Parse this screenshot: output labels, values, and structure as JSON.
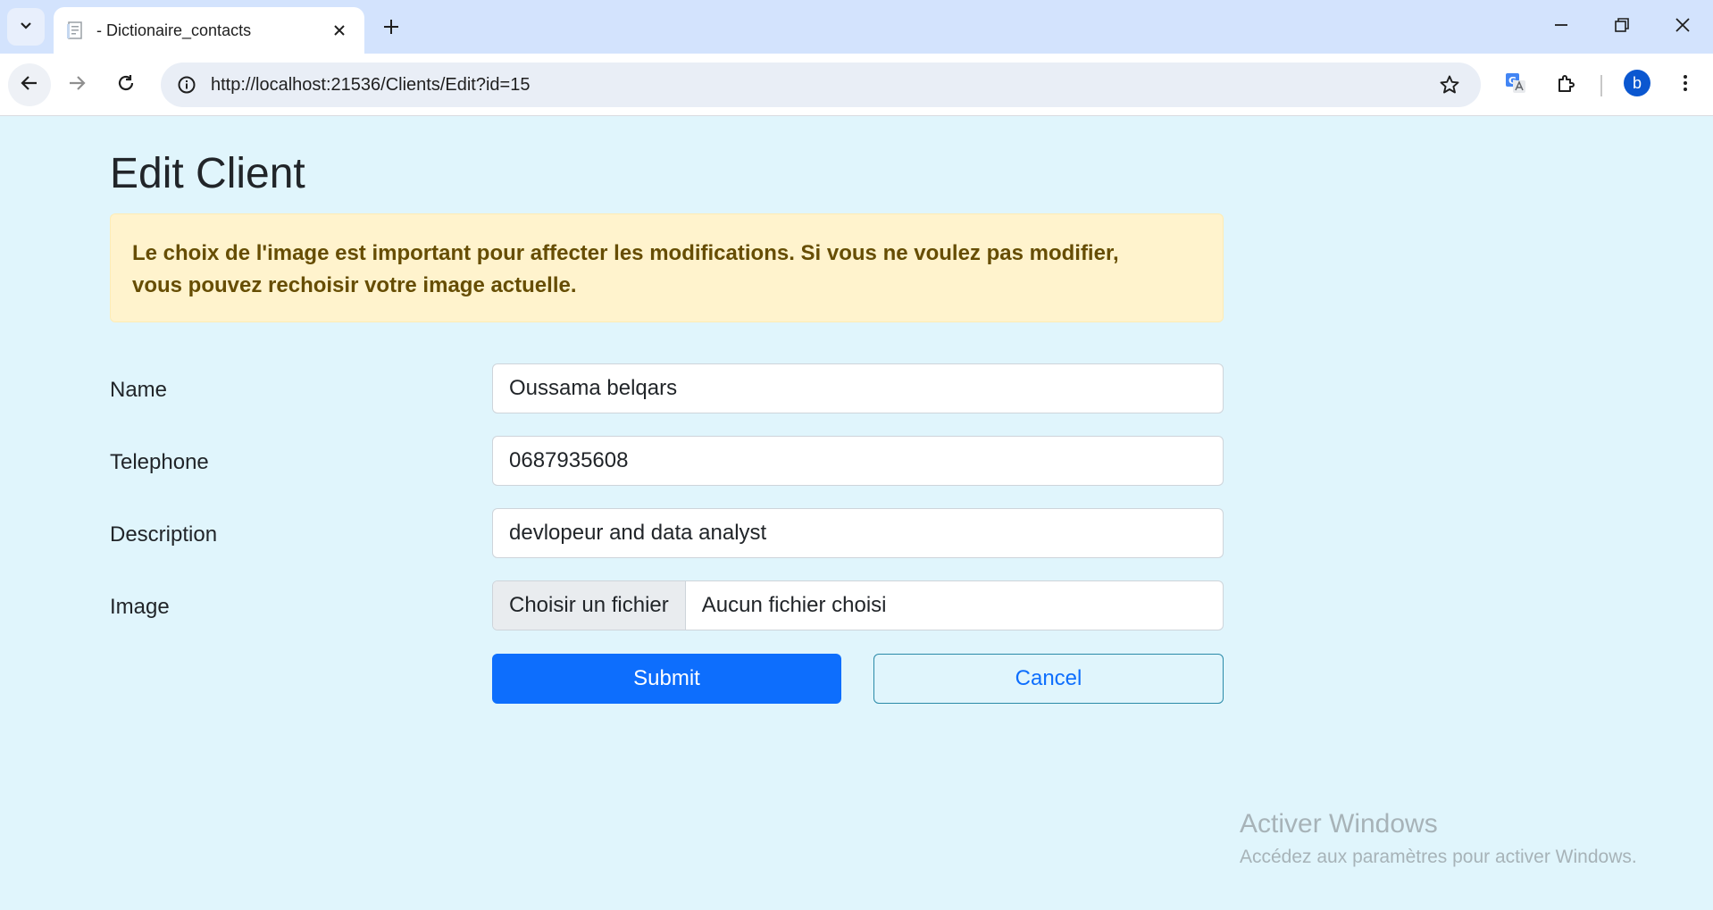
{
  "browser": {
    "tab_title": "- Dictionaire_contacts",
    "url": "http://localhost:21536/Clients/Edit?id=15",
    "profile_initial": "b"
  },
  "page": {
    "title": "Edit Client",
    "alert": "Le choix de l'image est important pour affecter les modifications. Si vous ne voulez pas modifier, vous pouvez rechoisir votre image actuelle.",
    "form": {
      "name_label": "Name",
      "name_value": "Oussama belqars",
      "telephone_label": "Telephone",
      "telephone_value": "0687935608",
      "description_label": "Description",
      "description_value": "devlopeur and data analyst",
      "image_label": "Image",
      "file_button": "Choisir un fichier",
      "file_status": "Aucun fichier choisi"
    },
    "submit_label": "Submit",
    "cancel_label": "Cancel"
  },
  "watermark": {
    "title": "Activer Windows",
    "subtitle": "Accédez aux paramètres pour activer Windows."
  },
  "colors": {
    "page_bg": "#e0f5fc",
    "primary": "#0d6efd",
    "alert_bg": "#fff3cd",
    "alert_text": "#664d03"
  },
  "icons": [
    "tab-search-icon",
    "page-favicon-icon",
    "close-icon",
    "plus-icon",
    "minimize-icon",
    "restore-icon",
    "window-close-icon",
    "back-icon",
    "forward-icon",
    "reload-icon",
    "info-icon",
    "star-icon",
    "translate-icon",
    "extensions-icon",
    "menu-dots-icon"
  ]
}
